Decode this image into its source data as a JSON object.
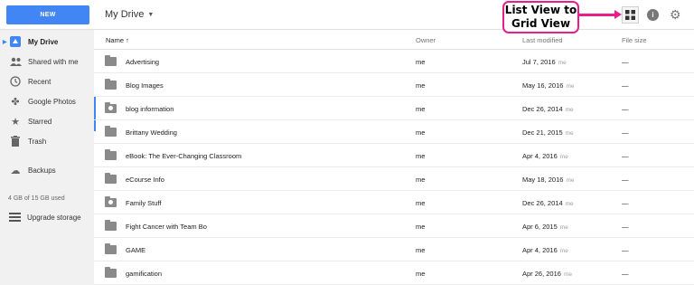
{
  "toolbar": {
    "new_label": "NEW",
    "breadcrumb": "My Drive",
    "caret": "▼",
    "info_glyph": "i",
    "gear_glyph": "⚙"
  },
  "callout": {
    "line1": "List View to",
    "line2": "Grid View",
    "color": "#e91e8c"
  },
  "sidebar": {
    "items": [
      {
        "label": "My Drive",
        "icon": "drive-icon",
        "glyph": "▣"
      },
      {
        "label": "Shared with me",
        "icon": "people-icon",
        "glyph": "👥"
      },
      {
        "label": "Recent",
        "icon": "clock-icon",
        "glyph": "◷"
      },
      {
        "label": "Google Photos",
        "icon": "pinwheel-icon",
        "glyph": "✤"
      },
      {
        "label": "Starred",
        "icon": "star-icon",
        "glyph": "★"
      },
      {
        "label": "Trash",
        "icon": "trash-icon",
        "glyph": "▮"
      },
      {
        "label": "Backups",
        "icon": "cloud-icon",
        "glyph": "☁"
      }
    ],
    "storage": "4 GB of 15 GB used",
    "upgrade": "Upgrade storage"
  },
  "table": {
    "headers": {
      "name": "Name ↑",
      "owner": "Owner",
      "modified": "Last modified",
      "size": "File size"
    },
    "rows": [
      {
        "name": "Advertising",
        "owner": "me",
        "modified": "Jul 7, 2016",
        "by": "me",
        "size": "—",
        "shared": false
      },
      {
        "name": "Blog Images",
        "owner": "me",
        "modified": "May 16, 2016",
        "by": "me",
        "size": "—",
        "shared": false
      },
      {
        "name": "blog information",
        "owner": "me",
        "modified": "Dec 26, 2014",
        "by": "me",
        "size": "—",
        "shared": true
      },
      {
        "name": "Brittany Wedding",
        "owner": "me",
        "modified": "Dec 21, 2015",
        "by": "me",
        "size": "—",
        "shared": false
      },
      {
        "name": "eBook: The Ever-Changing Classroom",
        "owner": "me",
        "modified": "Apr 4, 2016",
        "by": "me",
        "size": "—",
        "shared": false
      },
      {
        "name": "eCourse Info",
        "owner": "me",
        "modified": "May 18, 2016",
        "by": "me",
        "size": "—",
        "shared": false
      },
      {
        "name": "Family Stuff",
        "owner": "me",
        "modified": "Dec 26, 2014",
        "by": "me",
        "size": "—",
        "shared": true
      },
      {
        "name": "Fight Cancer with Team Bo",
        "owner": "me",
        "modified": "Apr 6, 2015",
        "by": "me",
        "size": "—",
        "shared": false
      },
      {
        "name": "GAME",
        "owner": "me",
        "modified": "Apr 4, 2016",
        "by": "me",
        "size": "—",
        "shared": false
      },
      {
        "name": "gamification",
        "owner": "me",
        "modified": "Apr 26, 2016",
        "by": "me",
        "size": "—",
        "shared": false
      }
    ]
  },
  "colors": {
    "accent": "#4285f4",
    "sidebar_bg": "#f1f1f1"
  }
}
